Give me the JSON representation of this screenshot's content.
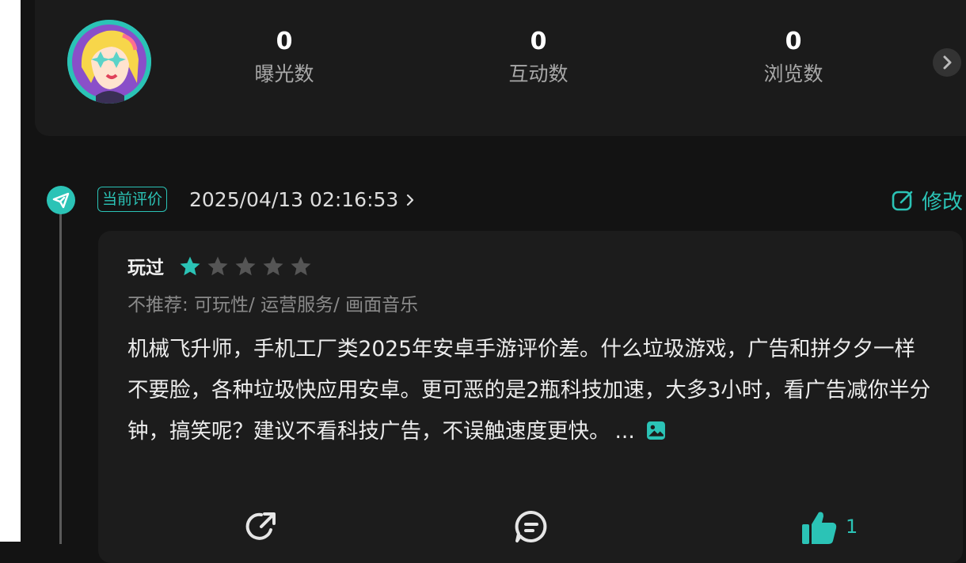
{
  "stats": [
    {
      "value": "0",
      "label": "曝光数"
    },
    {
      "value": "0",
      "label": "互动数"
    },
    {
      "value": "0",
      "label": "浏览数"
    }
  ],
  "review": {
    "badge": "当前评价",
    "datetime": "2025/04/13 02:16:53",
    "edit_label": "修改",
    "status": "玩过",
    "rating": 1,
    "rating_max": 5,
    "not_recommend": "不推荐: 可玩性/ 运营服务/ 画面音乐",
    "body": "机械飞升师，手机工厂类2025年安卓手游评价差。什么垃圾游戏，广告和拼夕夕一样不要脸，各种垃圾快应用安卓。更可恶的是2瓶科技加速，大多3小时，看广告减你半分钟，搞笑呢？建议不看科技广告，不误触速度更快。",
    "more": "...",
    "likes": "1"
  },
  "colors": {
    "accent": "#2bc3b6",
    "background": "#131313",
    "card": "#1c1c1c",
    "star_inactive": "#555555"
  },
  "icons": {
    "timeline": "send-icon",
    "edit": "edit-icon",
    "image": "image-icon",
    "share": "share-icon",
    "comment": "comment-icon",
    "like": "thumbs-up-icon"
  }
}
